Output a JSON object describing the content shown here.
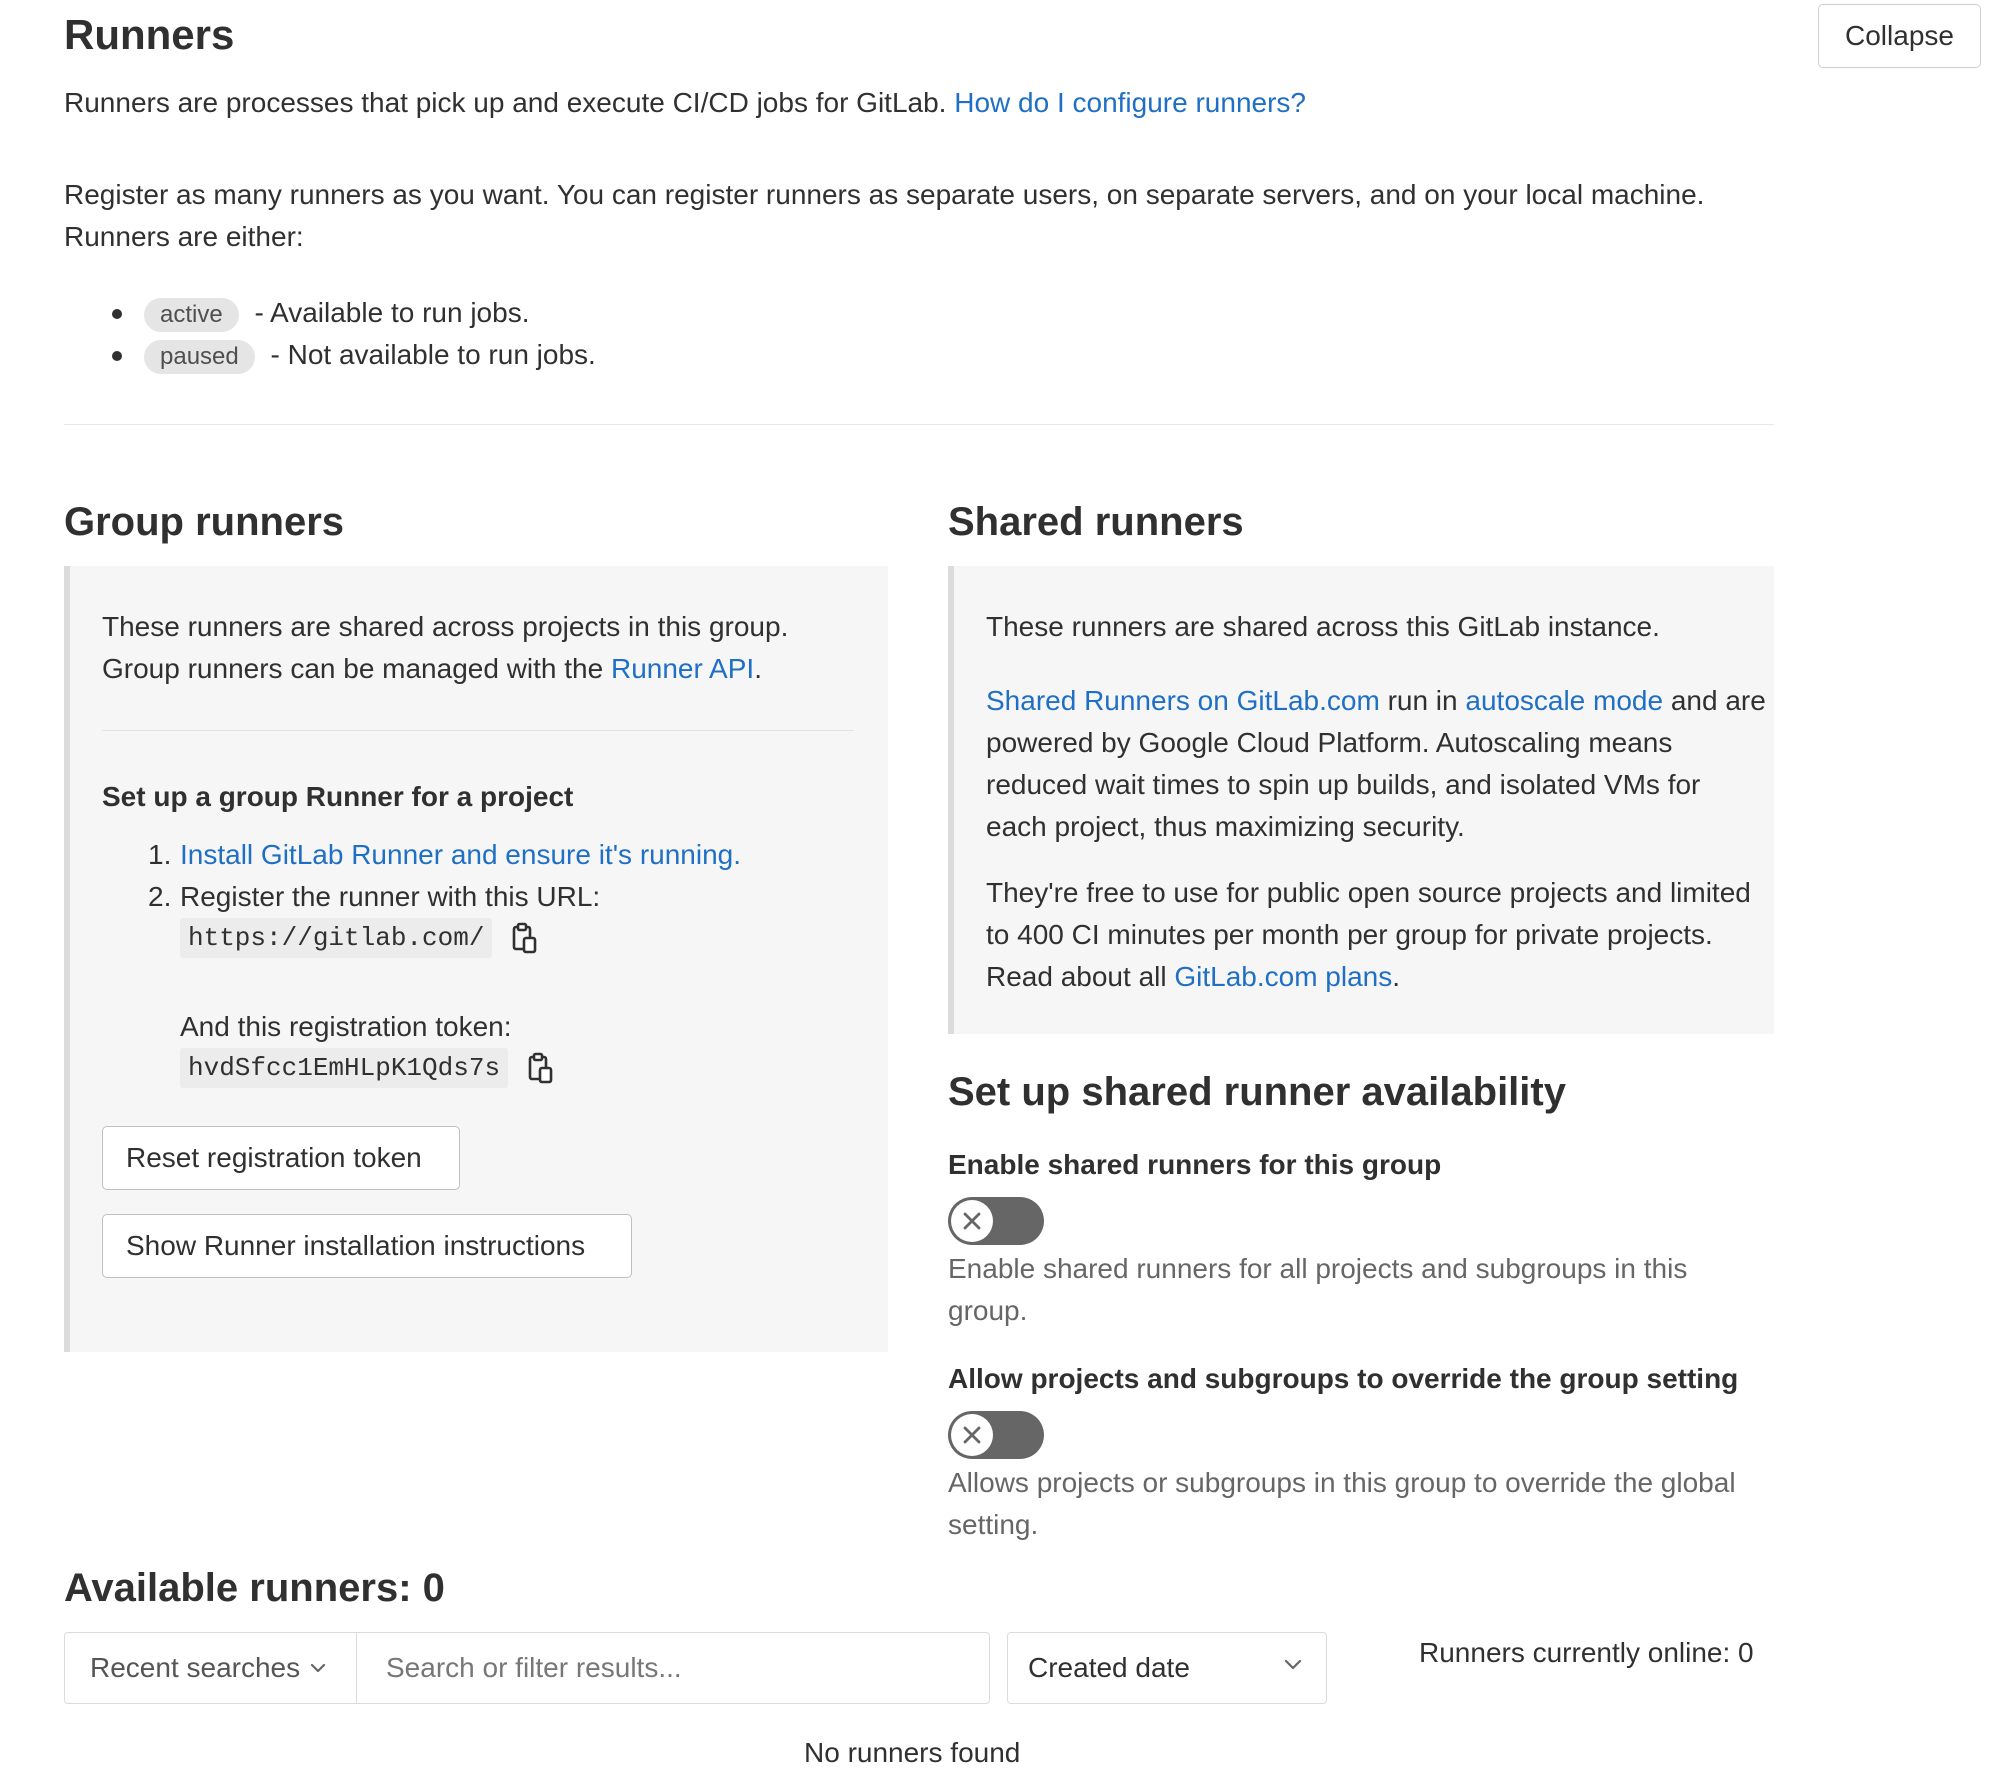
{
  "header": {
    "title": "Runners",
    "collapse_label": "Collapse",
    "intro_text": "Runners are processes that pick up and execute CI/CD jobs for GitLab.",
    "intro_link": "How do I configure runners?",
    "register_text": "Register as many runners as you want. You can register runners as separate users, on separate servers, and on your local machine. Runners are either:",
    "states": [
      {
        "badge": "active",
        "text": "- Available to run jobs."
      },
      {
        "badge": "paused",
        "text": "- Not available to run jobs."
      }
    ]
  },
  "group_runners": {
    "title": "Group runners",
    "desc_1": "These runners are shared across projects in this group. Group runners can be managed with the",
    "api_link": "Runner API",
    "period": ".",
    "setup_title": "Set up a group Runner for a project",
    "step1_num": "1.",
    "step1_link": "Install GitLab Runner and ensure it's running.",
    "step2_num": "2.",
    "step2_text": "Register the runner with this URL:",
    "url": "https://gitlab.com/",
    "token_label": "And this registration token:",
    "token": "hvdSfcc1EmHLpK1Qds7s",
    "reset_button": "Reset registration token",
    "show_instructions_button": "Show Runner installation instructions"
  },
  "shared_runners": {
    "title": "Shared runners",
    "desc_1": "These runners are shared across this GitLab instance.",
    "link_1": "Shared Runners on GitLab.com",
    "mid_1": "run in",
    "link_2": "autoscale mode",
    "desc_2": "and are powered by Google Cloud Platform. Autoscaling means reduced wait times to spin up builds, and isolated VMs for each project, thus maximizing security.",
    "desc_3": "They're free to use for public open source projects and limited to 400 CI minutes per month per group for private projects. Read about all",
    "link_3": "GitLab.com plans",
    "period": "."
  },
  "availability": {
    "title": "Set up shared runner availability",
    "enable_title": "Enable shared runners for this group",
    "enable_help": "Enable shared runners for all projects and subgroups in this group.",
    "enable_state": "off",
    "override_title": "Allow projects and subgroups to override the group setting",
    "override_help": "Allows projects or subgroups in this group to override the global setting.",
    "override_state": "off"
  },
  "available": {
    "title": "Available runners: 0",
    "recent_searches": "Recent searches",
    "search_placeholder": "Search or filter results...",
    "sort_label": "Created date",
    "online_text": "Runners currently online: 0",
    "empty_text": "No runners found"
  },
  "colors": {
    "link": "#1f6fc5",
    "toggle_off": "#666666",
    "panel_bg": "#f6f6f6"
  },
  "icons": [
    "copy-icon",
    "close-icon",
    "chevron-down-icon"
  ]
}
